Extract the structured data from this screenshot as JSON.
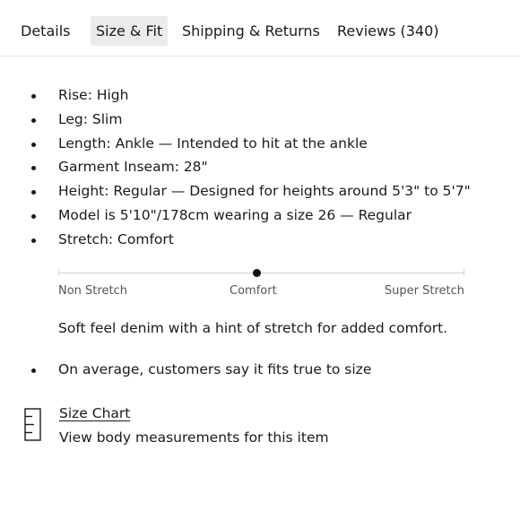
{
  "tabs": [
    {
      "label": "Details",
      "active": false
    },
    {
      "label": "Size & Fit",
      "active": true
    },
    {
      "label": "Shipping & Returns",
      "active": false
    },
    {
      "label": "Reviews (340)",
      "active": false
    }
  ],
  "specs": [
    "Rise: High",
    "Leg: Slim",
    "Length: Ankle — Intended to hit at the ankle",
    "Garment Inseam: 28\"",
    "Height: Regular — Designed for heights around 5'3\" to 5'7\"",
    "Model is 5'10\"/178cm wearing a size 26  —  Regular",
    "Stretch: Comfort"
  ],
  "stretch_scale": {
    "labels": [
      "Non Stretch",
      "Comfort",
      "Super Stretch"
    ],
    "selected": "Comfort",
    "selected_position": 0.49,
    "description": "Soft feel denim with a hint of stretch for added comfort."
  },
  "fit_note": "On average, customers say it fits true to size",
  "size_chart": {
    "link_label": "Size Chart",
    "subtext": "View body measurements for this item",
    "icon": "ruler-icon"
  }
}
